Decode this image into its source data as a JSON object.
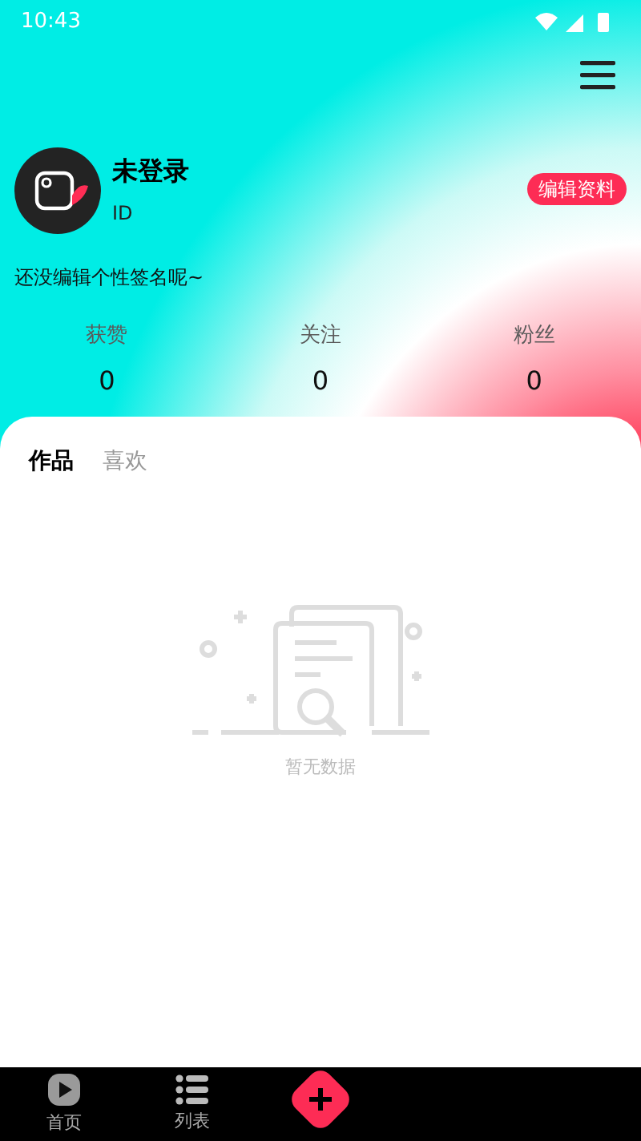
{
  "status_bar": {
    "time": "10:43"
  },
  "profile": {
    "name": "未登录",
    "id_label": "ID",
    "edit_button": "编辑资料",
    "signature": "还没编辑个性签名呢~"
  },
  "stats": [
    {
      "label": "获赞",
      "value": "0"
    },
    {
      "label": "关注",
      "value": "0"
    },
    {
      "label": "粉丝",
      "value": "0"
    }
  ],
  "tabs": [
    {
      "label": "作品",
      "selected": true
    },
    {
      "label": "喜欢",
      "selected": false
    }
  ],
  "empty_state": {
    "text": "暂无数据"
  },
  "bottom_nav": [
    {
      "kind": "play",
      "label": "首页"
    },
    {
      "kind": "list",
      "label": "列表"
    },
    {
      "kind": "add"
    }
  ]
}
